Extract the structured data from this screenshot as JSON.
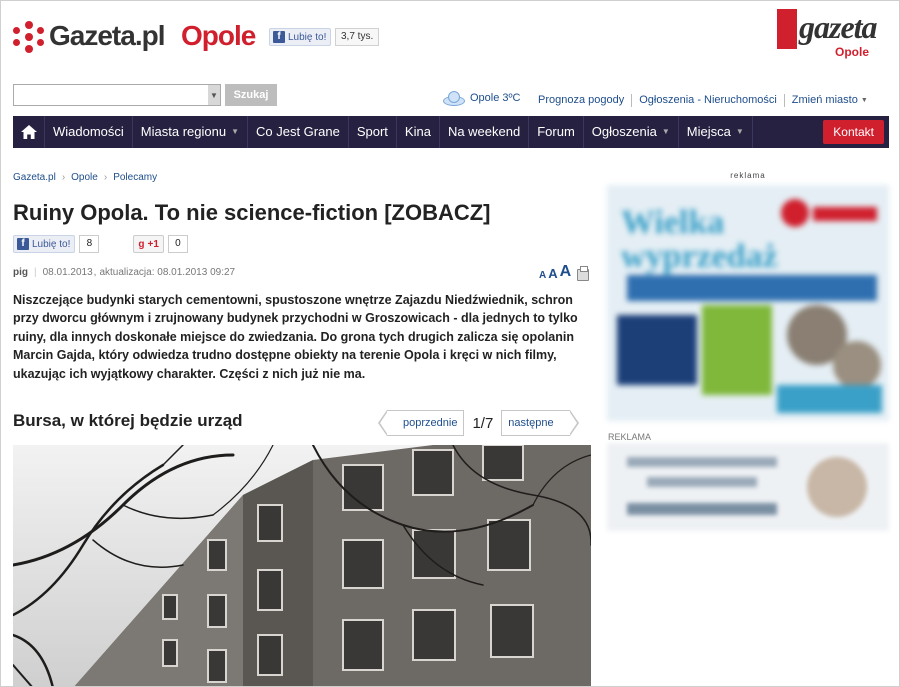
{
  "header": {
    "logo_text": "Gazeta.pl",
    "logo_city": "Opole",
    "fb_like_label": "Lubię to!",
    "fb_like_count": "3,7 tys.",
    "brand_word": "gazeta",
    "brand_city": "Opole"
  },
  "search": {
    "value": "",
    "button_label": "Szukaj"
  },
  "weather": {
    "text": "Opole 3ºC",
    "icon": "cloud-icon"
  },
  "top_links": [
    "Prognoza pogody",
    "Ogłoszenia - Nieruchomości",
    "Zmień miasto"
  ],
  "nav": {
    "items": [
      "Wiadomości",
      "Miasta regionu",
      "Co Jest Grane",
      "Sport",
      "Kina",
      "Na weekend",
      "Forum",
      "Ogłoszenia",
      "Miejsca"
    ],
    "contact_label": "Kontakt",
    "colors": {
      "bar": "#262140",
      "contact": "#d0202e"
    }
  },
  "breadcrumb": [
    "Gazeta.pl",
    "Opole",
    "Polecamy"
  ],
  "article": {
    "title": "Ruiny Opola. To nie science-fiction [ZOBACZ]",
    "fb_like_label": "Lubię to!",
    "fb_like_count": "8",
    "gplus_label": "+1",
    "gplus_count": "0",
    "author": "pig",
    "date": "08.01.2013",
    "updated": "aktualizacja: 08.01.2013 09:27",
    "font_sizes_label": [
      "A",
      "A",
      "A"
    ],
    "lead": "Niszczejące budynki starych cementowni, spustoszone wnętrze Zajazdu Niedźwiednik, schron przy dworcu głównym i zrujnowany budynek przychodni w Groszowicach - dla jednych to tylko ruiny, dla innych doskonałe miejsce do zwiedzania. Do grona tych drugich zalicza się opolanin Marcin Gajda, który odwiedza trudno dostępne obiekty na terenie Opola i kręci w nich filmy, ukazując ich wyjątkowy charakter. Części z nich już nie ma."
  },
  "gallery": {
    "caption": "Bursa, w której będzie urząd",
    "prev_label": "poprzednie",
    "counter": "1/7",
    "next_label": "następne"
  },
  "sidebar": {
    "ad_label": "reklama",
    "ad2_label": "REKLAMA"
  }
}
